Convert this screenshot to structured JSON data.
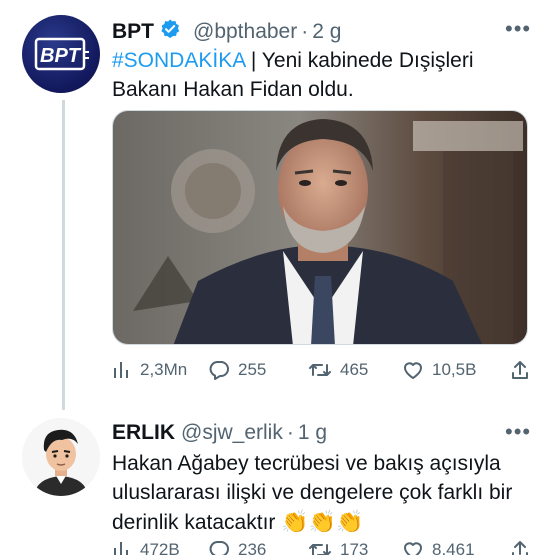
{
  "tweets": [
    {
      "author": {
        "name": "BPT",
        "handle": "@bpthaber",
        "separator": "·",
        "age": "2 g",
        "logo_text": "BPT"
      },
      "text": {
        "hashtag": "#SONDAKİKA",
        "rest": " | Yeni kabinede Dışişleri Bakanı Hakan Fidan oldu."
      },
      "stats": {
        "views": "2,3Mn",
        "replies": "255",
        "retweets": "465",
        "likes": "10,5B"
      }
    },
    {
      "author": {
        "name": "ERLIK",
        "handle": "@sjw_erlik",
        "separator": "·",
        "age": "1 g"
      },
      "text": {
        "body": "Hakan Ağabey tecrübesi ve bakış açısıyla uluslararası ilişki ve dengelere çok farklı bir derinlik katacaktır ",
        "emojis": "👏👏👏"
      },
      "stats": {
        "views": "472B",
        "replies": "236",
        "retweets": "173",
        "likes": "8.461"
      }
    }
  ],
  "colors": {
    "text": "#0f1419",
    "secondary": "#536471",
    "accent": "#1d9bf0",
    "line": "#cfd9de"
  }
}
